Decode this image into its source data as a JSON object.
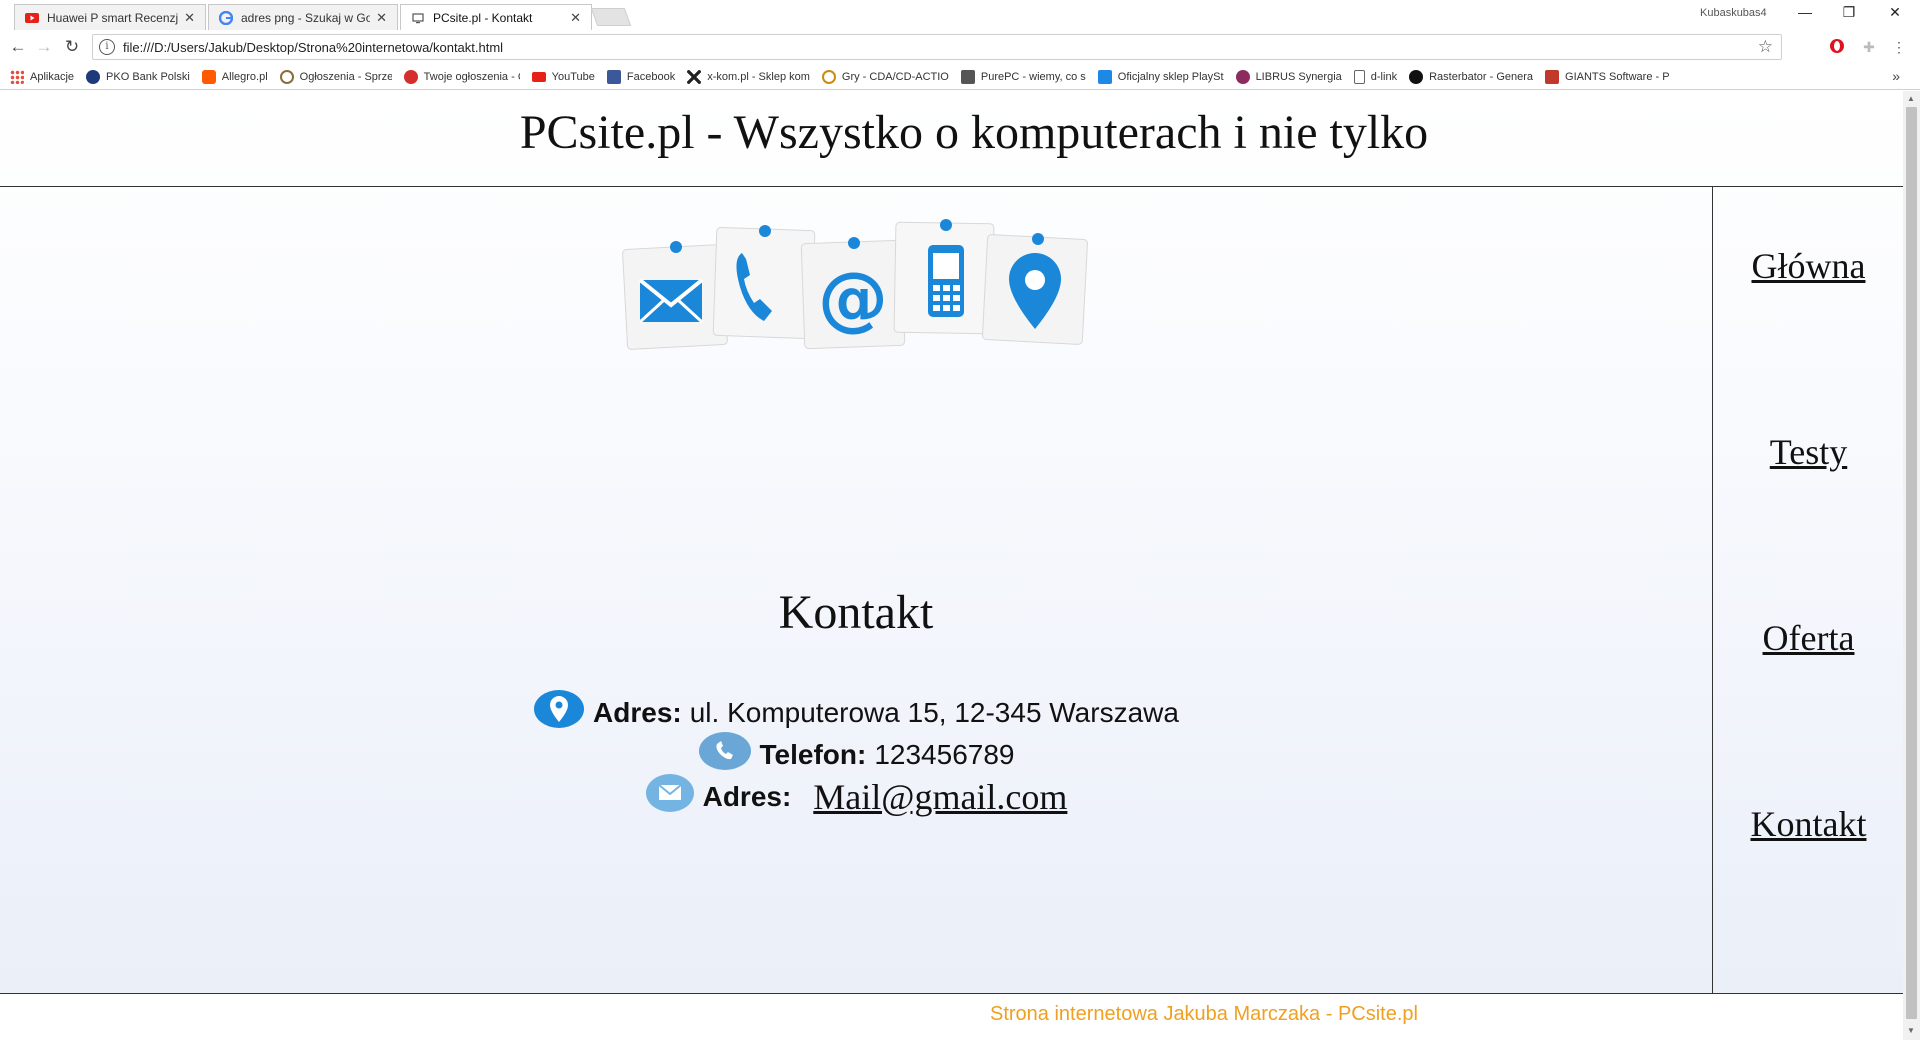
{
  "browser": {
    "tabs": [
      {
        "title": "Huawei P smart Recenzja",
        "favicon": "youtube-icon"
      },
      {
        "title": "adres png - Szukaj w Go",
        "favicon": "google-icon"
      },
      {
        "title": "PCsite.pl - Kontakt",
        "favicon": "page-icon",
        "active": true
      }
    ],
    "profile_name": "Kubaskubas4",
    "address_url": "file:///D:/Users/Jakub/Desktop/Strona%20internetowa/kontakt.html",
    "bookmarks": [
      {
        "label": "Aplikacje",
        "icon": "apps-grid-icon",
        "color": "#e84c3d"
      },
      {
        "label": "PKO Bank Polski",
        "icon": "pko-icon",
        "color": "#1f3a7a"
      },
      {
        "label": "Allegro.pl",
        "icon": "allegro-icon",
        "color": "#ff5a00"
      },
      {
        "label": "Ogłoszenia - Sprzeda",
        "icon": "olx-icon",
        "color": "#8a6d3b"
      },
      {
        "label": "Twoje ogłoszenia - O",
        "icon": "olx-red-icon",
        "color": "#d62d2d"
      },
      {
        "label": "YouTube",
        "icon": "youtube-icon",
        "color": "#e62117"
      },
      {
        "label": "Facebook",
        "icon": "facebook-icon",
        "color": "#3b5998"
      },
      {
        "label": "x-kom.pl - Sklep kom",
        "icon": "xkom-icon",
        "color": "#222222"
      },
      {
        "label": "Gry - CDA/CD-ACTIO",
        "icon": "cda-icon",
        "color": "#c98b12"
      },
      {
        "label": "PurePC - wiemy, co s",
        "icon": "purepc-icon",
        "color": "#555555"
      },
      {
        "label": "Oficjalny sklep PlaySt",
        "icon": "playstation-icon",
        "color": "#1e88e5"
      },
      {
        "label": "LIBRUS Synergia",
        "icon": "librus-icon",
        "color": "#8e2b5e"
      },
      {
        "label": "d-link",
        "icon": "page-icon",
        "color": "#ffffff"
      },
      {
        "label": "Rasterbator - Genera",
        "icon": "rasterbator-icon",
        "color": "#111111"
      },
      {
        "label": "GIANTS Software - P",
        "icon": "giants-icon",
        "color": "#c0392b"
      }
    ]
  },
  "site": {
    "header_title": "PCsite.pl - Wszystko o komputerach i nie tylko",
    "nav": [
      "Główna",
      "Testy",
      "Oferta",
      "Kontakt"
    ],
    "section_title": "Kontakt",
    "address_label": "Adres:",
    "address_value": "ul. Komputerowa 15, 12-345 Warszawa",
    "phone_label": "Telefon:",
    "phone_value": "123456789",
    "email_label": "Adres:",
    "email_value": "Mail@gmail.com",
    "footer_text": "Strona internetowa Jakuba Marczaka - PCsite.pl",
    "colors": {
      "accent_blue": "#1b87d8",
      "footer_text": "#f0a020"
    }
  }
}
